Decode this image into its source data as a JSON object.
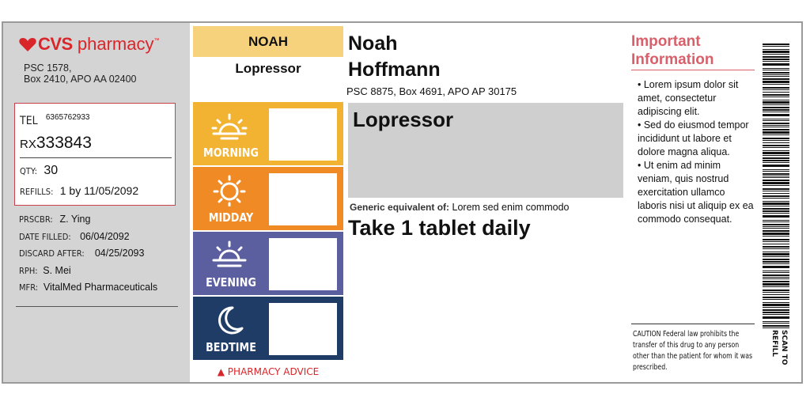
{
  "pharmacy": {
    "brand": "CVS",
    "brand_suffix": "pharmacy",
    "trademark": "™",
    "address_line1": "PSC 1578,",
    "address_line2": "Box 2410, APO AA 02400",
    "brand_color": "#d9262a"
  },
  "rx": {
    "tel_label": "TEL",
    "tel": "6365762933",
    "rx_label": "RX",
    "rx_number": "333843",
    "qty_label": "QTY:",
    "qty": "30",
    "refills_label": "REFILLS:",
    "refills": "1 by 11/05/2092"
  },
  "meta": {
    "prescriber_label": "PRSCBR:",
    "prescriber": "Z. Ying",
    "date_filled_label": "DATE FILLED:",
    "date_filled": "06/04/2092",
    "discard_label": "DISCARD AFTER:",
    "discard": "04/25/2093",
    "rph_label": "RPH:",
    "rph": "S. Mei",
    "mfr_label": "MFR:",
    "mfr": "VitalMed Pharmaceuticals"
  },
  "dosage": {
    "patient_first_upper": "NOAH",
    "drug_name_small": "Lopressor",
    "slots": [
      {
        "label": "MORNING",
        "icon": "sunrise-icon",
        "color": "#f2b232"
      },
      {
        "label": "MIDDAY",
        "icon": "sun-icon",
        "color": "#f08a24"
      },
      {
        "label": "EVENING",
        "icon": "sunset-icon",
        "color": "#5b5f9f"
      },
      {
        "label": "BEDTIME",
        "icon": "moon-icon",
        "color": "#1f3c66"
      }
    ],
    "advice": "▲ PHARMACY ADVICE"
  },
  "patient": {
    "first_name": "Noah",
    "last_name": "Hoffmann",
    "address": "PSC 8875, Box 4691, APO AP 30175"
  },
  "drug": {
    "name": "Lopressor",
    "generic_label": "Generic equivalent of:",
    "generic_value": "Lorem sed enim commodo",
    "directions": "Take 1 tablet daily"
  },
  "important": {
    "title_line1": "Important",
    "title_line2": "Information",
    "bullets": [
      "• Lorem ipsum dolor sit amet, consectetur adipiscing elit.",
      "• Sed do eiusmod tempor incididunt ut labore et dolore magna aliqua.",
      "• Ut enim ad minim veniam, quis nostrud exercitation ullamco laboris nisi ut aliquip ex ea commodo consequat."
    ],
    "caution": "CAUTION Federal law prohibits the transfer of this drug to any person other than the patient for whom it was prescribed.",
    "accent_color": "#d9606a"
  },
  "barcode": {
    "scan_label": "SCAN TO REFILL"
  }
}
